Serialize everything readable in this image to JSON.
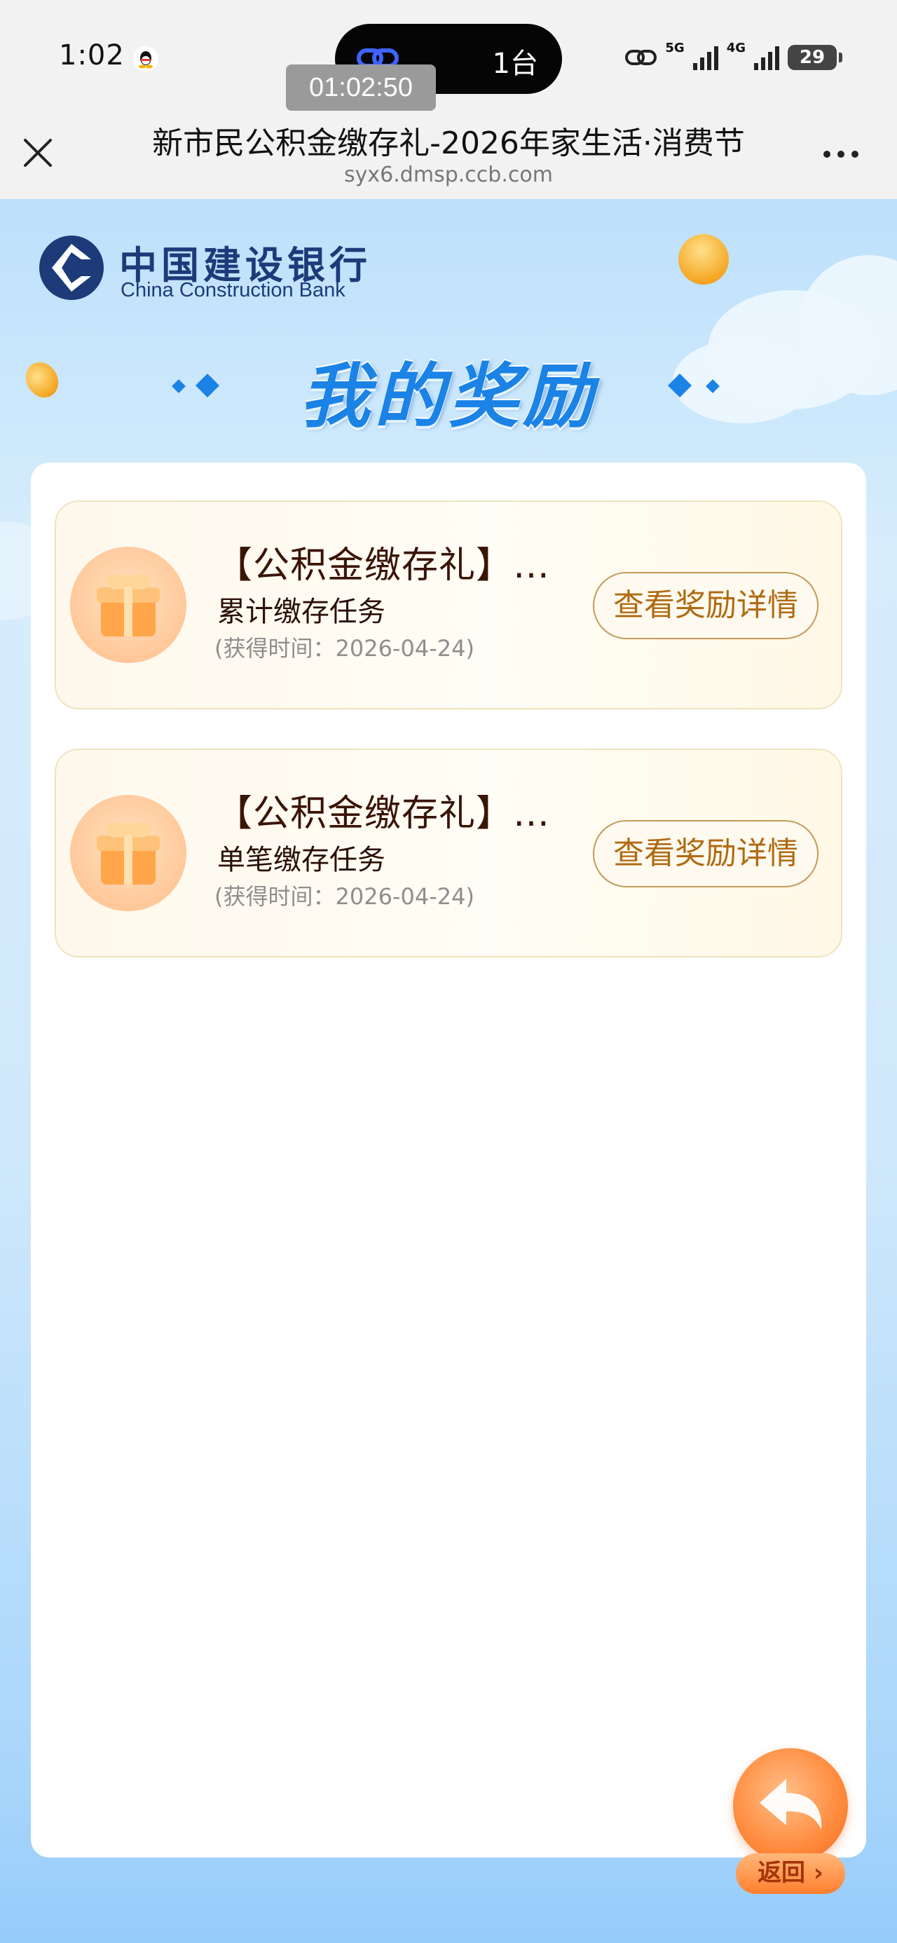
{
  "status_bar": {
    "time": "1:02",
    "island_count": "1台",
    "recording_timer": "01:02:50",
    "network_1": "5G",
    "network_2": "4G",
    "battery": "29"
  },
  "browser": {
    "title": "新市民公积金缴存礼-2026年家生活·消费节",
    "url": "syx6.dmsp.ccb.com"
  },
  "brand": {
    "name_cn": "中国建设银行",
    "name_en": "China Construction Bank",
    "color": "#1d3b79"
  },
  "rewards": {
    "heading": "我的奖励",
    "items": [
      {
        "title": "【公积金缴存礼】…",
        "subtitle": "累计缴存任务",
        "time": "(获得时间：2026-04-24)",
        "button": "查看奖励详情",
        "icon": "gift-icon"
      },
      {
        "title": "【公积金缴存礼】…",
        "subtitle": "单笔缴存任务",
        "time": "(获得时间：2026-04-24)",
        "button": "查看奖励详情",
        "icon": "gift-icon"
      }
    ]
  },
  "back_button": {
    "label": "返回 ›",
    "icon": "back-arrow-icon"
  },
  "colors": {
    "accent_blue": "#1b82e6",
    "button_text": "#b16a12",
    "button_border": "#c39a5a"
  }
}
